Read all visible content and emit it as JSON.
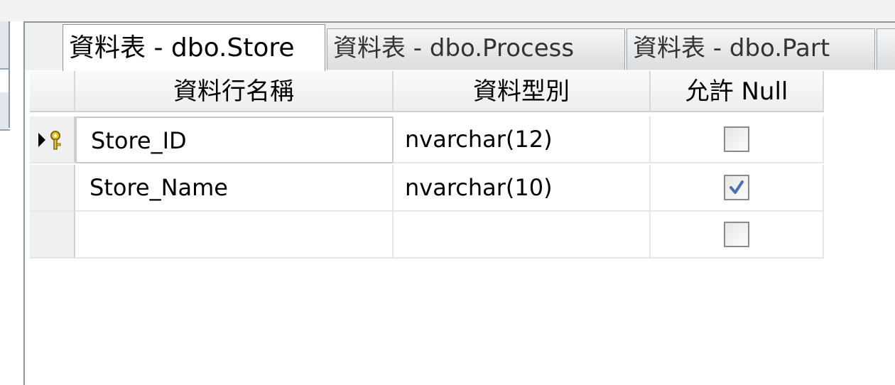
{
  "tabs": [
    {
      "label": "資料表 - dbo.Store",
      "active": true
    },
    {
      "label": "資料表 - dbo.Process",
      "active": false
    },
    {
      "label": "資料表 - dbo.Part",
      "active": false
    }
  ],
  "grid": {
    "headers": {
      "column_name": "資料行名稱",
      "data_type": "資料型別",
      "allow_null": "允許 Null"
    },
    "rows": [
      {
        "name": "Store_ID",
        "type": "nvarchar(12)",
        "allow_null": false,
        "primary_key": true,
        "current": true
      },
      {
        "name": "Store_Name",
        "type": "nvarchar(10)",
        "allow_null": true,
        "primary_key": false,
        "current": false
      },
      {
        "name": "",
        "type": "",
        "allow_null": false,
        "primary_key": false,
        "current": false
      }
    ]
  },
  "colors": {
    "check": "#4a6fb5",
    "key": "#e8c33a"
  },
  "icons": {
    "row_indicator": "arrow-key-icon",
    "check": "checkmark-icon"
  }
}
